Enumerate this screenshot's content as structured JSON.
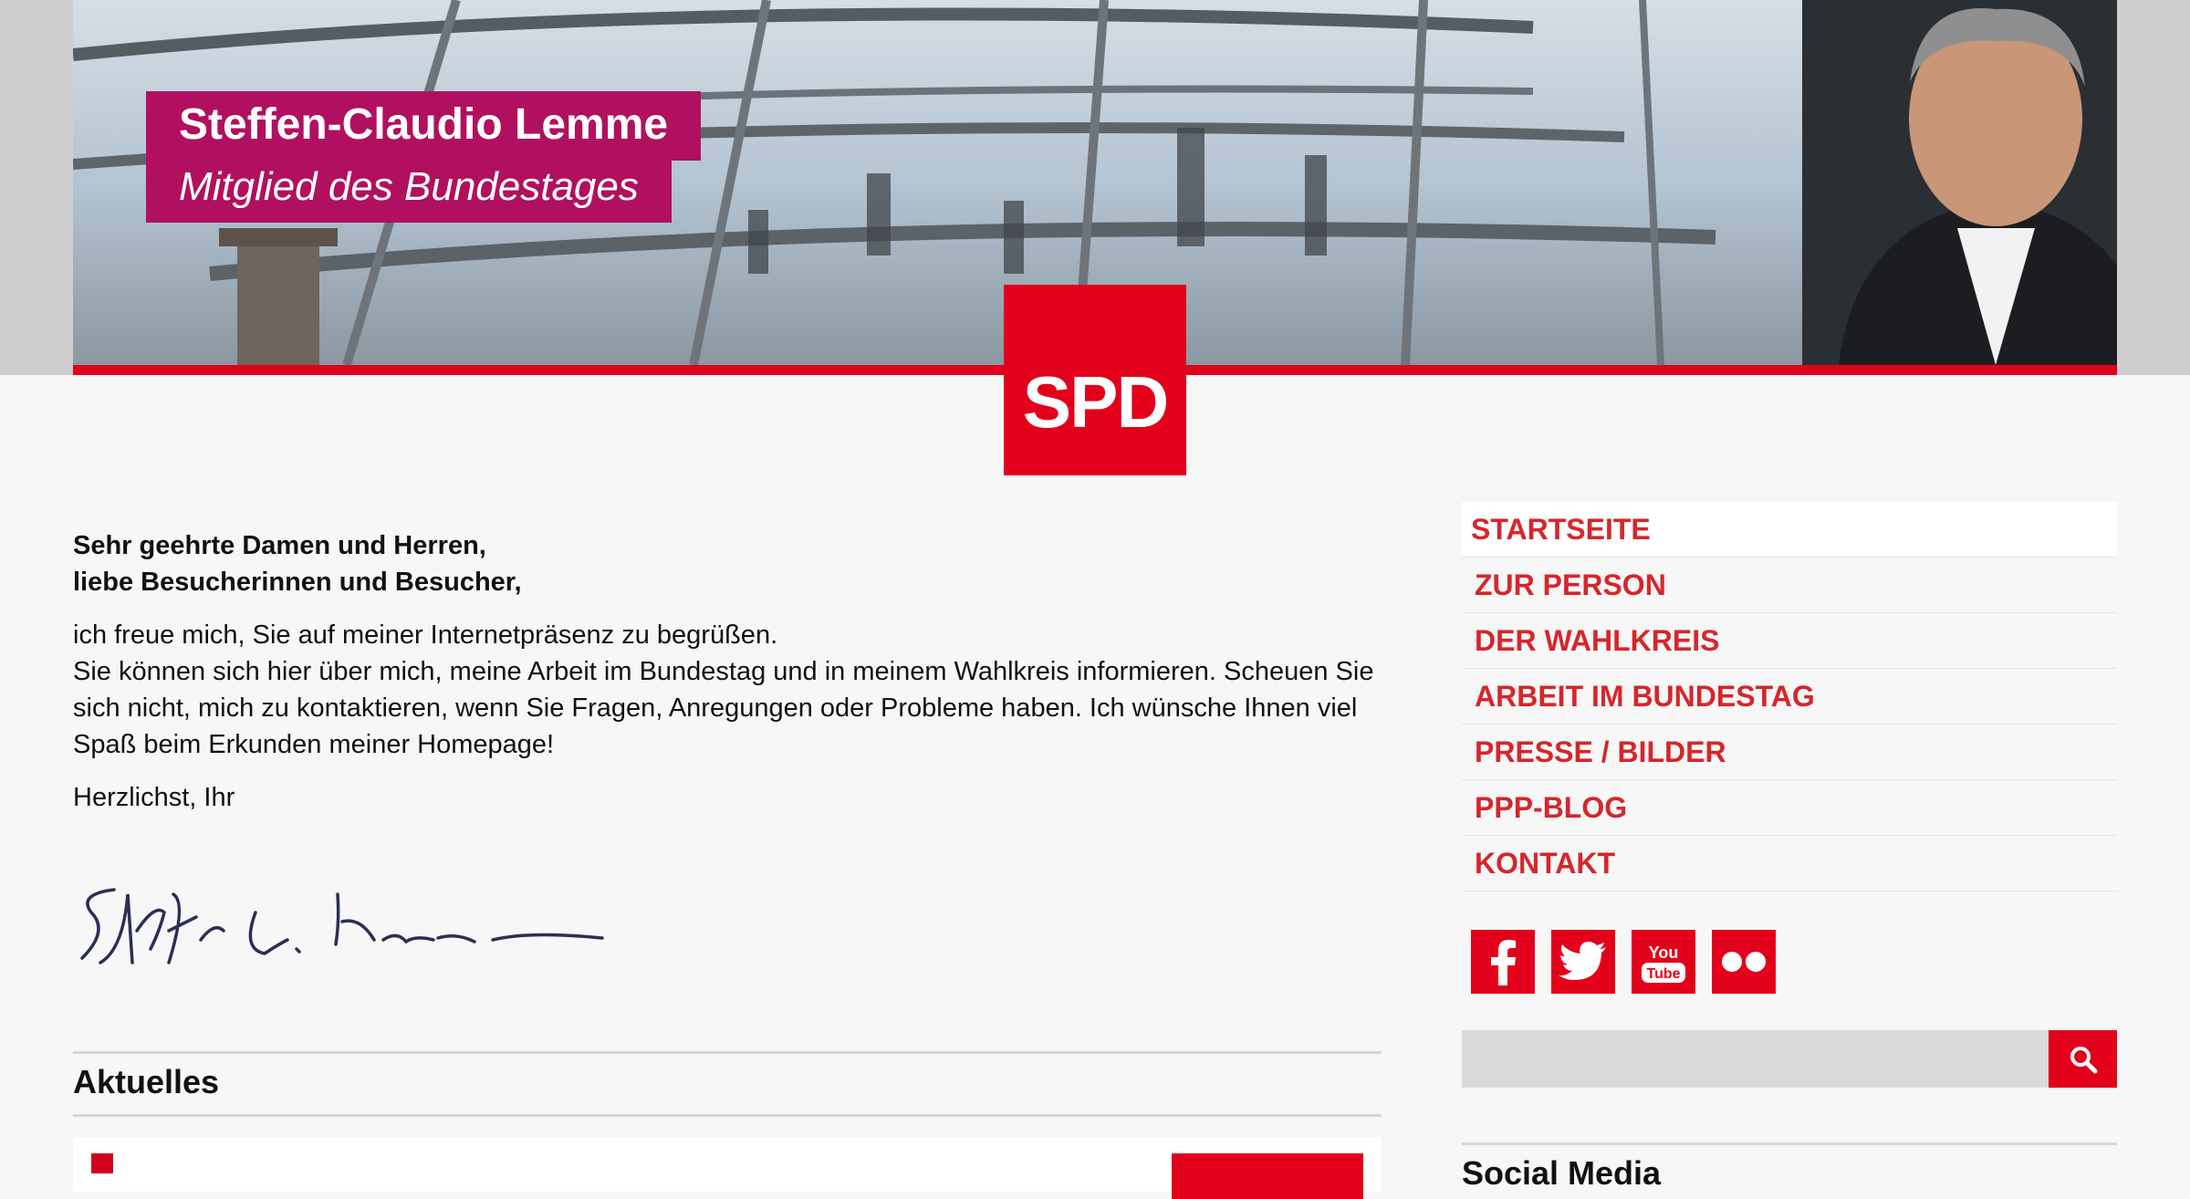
{
  "header": {
    "name": "Steffen-Claudio Lemme",
    "role": "Mitglied des Bundestages",
    "logo_text": "SPD"
  },
  "colors": {
    "spd_red": "#e3001b",
    "title_magenta": "#b0105f",
    "nav_red": "#d6262b",
    "background": "#f7f7f7"
  },
  "welcome": {
    "greeting_line1": "Sehr geehrte Damen und Herren,",
    "greeting_line2": "liebe Besucherinnen und Besucher,",
    "body_line1": "ich freue mich, Sie auf meiner Internetpräsenz zu begrüßen.",
    "body_line2": "Sie können sich hier über mich, meine Arbeit im Bundestag und in meinem Wahlkreis informieren. Scheuen Sie sich nicht, mich zu kontaktieren, wenn Sie Fragen, Anregungen oder Probleme haben. Ich wünsche Ihnen viel Spaß beim Erkunden meiner Homepage!",
    "sign_off": "Herzlichst, Ihr",
    "signature_icon": "handwritten-signature"
  },
  "news": {
    "heading": "Aktuelles"
  },
  "nav": {
    "items": [
      {
        "label": "STARTSEITE",
        "active": true
      },
      {
        "label": "ZUR PERSON"
      },
      {
        "label": "DER WAHLKREIS"
      },
      {
        "label": "ARBEIT IM BUNDESTAG"
      },
      {
        "label": "PRESSE / BILDER"
      },
      {
        "label": "PPP-BLOG"
      },
      {
        "label": "KONTAKT"
      }
    ]
  },
  "social": {
    "icons": [
      "facebook-icon",
      "twitter-icon",
      "youtube-icon",
      "flickr-icon"
    ],
    "youtube_text_1": "You",
    "youtube_text_2": "Tube"
  },
  "search": {
    "placeholder": "",
    "button_icon": "search-icon"
  },
  "sidebar": {
    "social_media_heading": "Social Media"
  }
}
